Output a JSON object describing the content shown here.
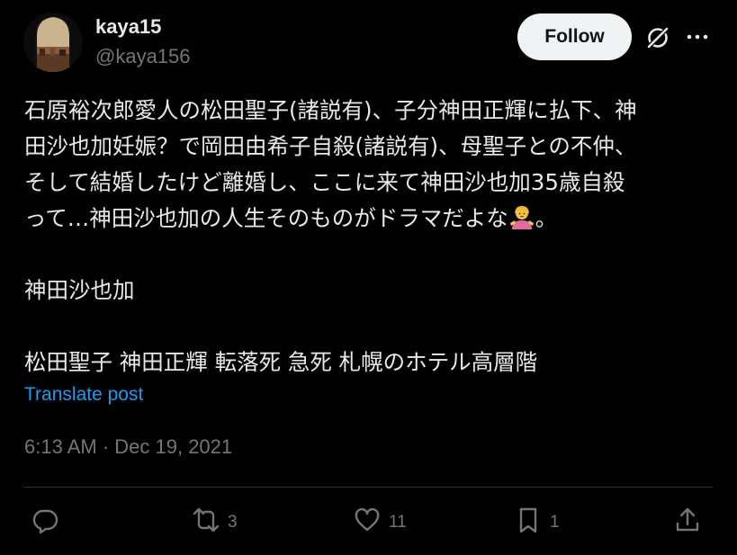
{
  "author": {
    "name": "kaya15",
    "handle": "@kaya156"
  },
  "follow_label": "Follow",
  "post": {
    "lines": [
      "石原裕次郎愛人の松田聖子(諸説有)、子分神田正輝に払下、神",
      "田沙也加妊娠？で岡田由希子自殺(諸説有)、母聖子との不仲、",
      "そして結婚したけど離婚し、ここに来て神田沙也加35歳自殺",
      "って…神田沙也加の人生そのものがドラマだよな"
    ],
    "line4_tail": "。",
    "line_name": "神田沙也加",
    "line_tags": "松田聖子 神田正輝 転落死 急死 札幌のホテル高層階"
  },
  "translate_label": "Translate post",
  "timestamp": "6:13 AM · Dec 19, 2021",
  "actions": {
    "replies": "",
    "reposts": "3",
    "likes": "11",
    "bookmarks": "1"
  },
  "icons": {
    "grok": "grok-icon",
    "more": "more-icon",
    "reply": "reply-icon",
    "repost": "repost-icon",
    "like": "heart-icon",
    "bookmark": "bookmark-icon",
    "share": "share-icon",
    "emoji": "person-shrugging-emoji"
  },
  "colors": {
    "background": "#000000",
    "text": "#e7e9ea",
    "secondary": "#71767b",
    "link": "#1d9bf0",
    "follow_bg": "#eff3f4"
  }
}
